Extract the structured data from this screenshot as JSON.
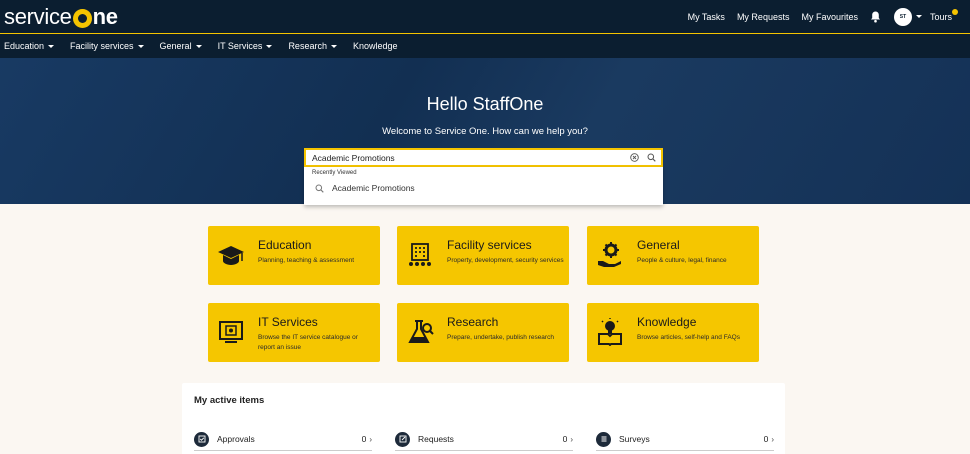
{
  "header": {
    "logo_text": "serviceOne",
    "links": [
      "My Tasks",
      "My Requests",
      "My Favourites"
    ],
    "avatar_initials": "ST",
    "tours_label": "Tours",
    "accent": "#f5c400",
    "bg": "#0b1e30"
  },
  "nav": {
    "items": [
      {
        "label": "Education",
        "has_caret": true
      },
      {
        "label": "Facility services",
        "has_caret": true
      },
      {
        "label": "General",
        "has_caret": true
      },
      {
        "label": "IT Services",
        "has_caret": true
      },
      {
        "label": "Research",
        "has_caret": true
      },
      {
        "label": "Knowledge",
        "has_caret": false
      }
    ]
  },
  "hero": {
    "title": "Hello StaffOne",
    "subtitle": "Welcome to Service One. How can we help you?"
  },
  "search": {
    "value": "Academic Promotions",
    "recent_heading": "Recently Viewed",
    "recent_items": [
      "Academic Promotions"
    ]
  },
  "cards": [
    {
      "title": "Education",
      "desc": "Planning, teaching & assessment",
      "icon": "graduation-cap-icon"
    },
    {
      "title": "Facility services",
      "desc": "Property, development, security services",
      "icon": "building-icon"
    },
    {
      "title": "General",
      "desc": "People & culture, legal, finance",
      "icon": "gear-hand-icon"
    },
    {
      "title": "IT Services",
      "desc": "Browse the IT service catalogue or report an issue",
      "icon": "monitor-icon"
    },
    {
      "title": "Research",
      "desc": "Prepare, undertake, publish research",
      "icon": "flask-icon"
    },
    {
      "title": "Knowledge",
      "desc": "Browse articles, self-help and FAQs",
      "icon": "lightbulb-book-icon"
    }
  ],
  "active_items": {
    "title": "My active items",
    "items": [
      {
        "label": "Approvals",
        "count": "0",
        "icon": "check-icon"
      },
      {
        "label": "Requests",
        "count": "0",
        "icon": "edit-icon"
      },
      {
        "label": "Surveys",
        "count": "0",
        "icon": "list-icon"
      }
    ]
  }
}
